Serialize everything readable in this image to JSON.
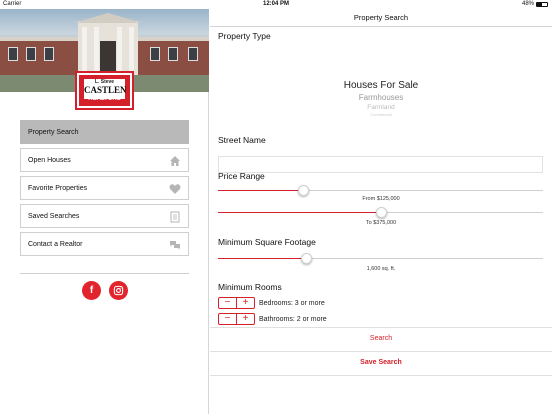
{
  "status_bar": {
    "carrier": "Carrier",
    "time": "12:04 PM",
    "battery": "48%",
    "battery_level": 0.48
  },
  "sidebar": {
    "logo": {
      "top": "L. Steve",
      "name": "CASTLEN",
      "tagline": "REALTORS"
    },
    "items": [
      {
        "label": "Property Search",
        "icon": "",
        "active": true
      },
      {
        "label": "Open Houses",
        "icon": "home-icon",
        "active": false
      },
      {
        "label": "Favorite Properties",
        "icon": "heart-icon",
        "active": false
      },
      {
        "label": "Saved Searches",
        "icon": "document-icon",
        "active": false
      },
      {
        "label": "Contact a Realtor",
        "icon": "chat-icon",
        "active": false
      }
    ],
    "social": [
      {
        "icon": "facebook-icon",
        "glyph": "f"
      },
      {
        "icon": "instagram-icon",
        "glyph": ""
      }
    ]
  },
  "main": {
    "title": "Property Search",
    "property_type": {
      "label": "Property Type",
      "selected": "Houses For Sale",
      "options_below": [
        "Farmhouses",
        "Farmland",
        "Commercial"
      ]
    },
    "street": {
      "label": "Street Name",
      "value": "",
      "placeholder": ""
    },
    "price": {
      "label": "Price Range",
      "from_label": "From $125,000",
      "to_label": "To $375,000",
      "from_fraction": 0.26,
      "to_fraction": 0.5
    },
    "sqft": {
      "label": "Minimum Square Footage",
      "value_label": "1,600 sq. ft.",
      "fraction": 0.27
    },
    "rooms": {
      "label": "Minimum Rooms",
      "bedrooms": "Bedrooms: 3 or more",
      "bathrooms": "Bathrooms: 2 or more",
      "minus": "−",
      "plus": "+"
    },
    "search_label": "Search",
    "save_label": "Save Search"
  },
  "colors": {
    "accent": "#d3202a",
    "active_item": "#b9b9b9",
    "divider": "#d4d4d4"
  }
}
